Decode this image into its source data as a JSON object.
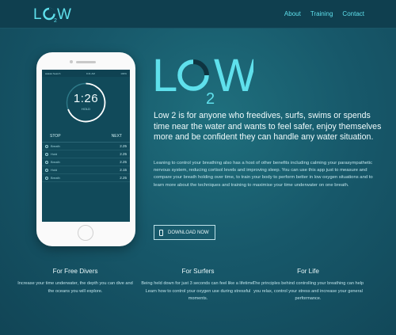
{
  "brand": {
    "logo_text": "LO2W",
    "accent": "#5fe0ec"
  },
  "nav": {
    "items": [
      "About",
      "Training",
      "Contact"
    ]
  },
  "app": {
    "status_left": "●●●●● Search",
    "status_time": "9:41 AM",
    "status_right": "100%",
    "timer": "1:26",
    "timer_label": "HOLD",
    "stop_label": "STOP",
    "next_label": "NEXT",
    "rows": [
      {
        "label": "Breath",
        "value": "2.25"
      },
      {
        "label": "Hold",
        "value": "2.25"
      },
      {
        "label": "Breath",
        "value": "2.25"
      },
      {
        "label": "Hold",
        "value": "2.15"
      },
      {
        "label": "Breath",
        "value": "2.25"
      }
    ]
  },
  "hero": {
    "title": "Low 2 is for anyone who freedives, surfs, swims or spends time near the water and wants to feel safer, enjoy themselves more and be confident they can handle any water situation.",
    "body": "Leaning to control your breathing also has a host of other benefits including calming your parasympathetic nervous system, reducing cortisol levels and improving sleep. You can use this app just to measure and compare your breath holding over time, to train your body to perform better in low oxygen situations and to learn more about the techniques and training to maximise your time underwater on one breath.",
    "download_label": "DOWNLOAD NOW"
  },
  "features": [
    {
      "title": "For Free Divers",
      "text": "Increase your time underwater, the depth you can dive and the oceans you will explore."
    },
    {
      "title": "For Surfers",
      "text": "Being held down for just 3 seconds can feel like a lifetime. Learn how to control your oxygen use during stressful moments."
    },
    {
      "title": "For Life",
      "text": "The principles behind controlling your breathing can help you relax, control your stress and increase your general performance."
    }
  ]
}
